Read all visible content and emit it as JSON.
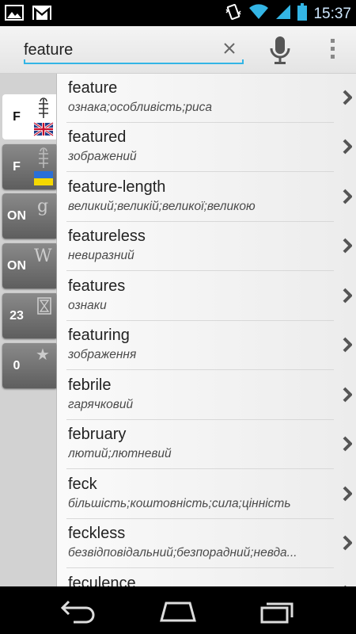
{
  "status_bar": {
    "time": "15:37",
    "left_icons": [
      "image-notification-icon",
      "gmail-notification-icon"
    ],
    "right_icons": [
      "vibrate-icon",
      "wifi-icon",
      "signal-icon",
      "battery-icon"
    ]
  },
  "search": {
    "value": "feature"
  },
  "tabs": [
    {
      "label": "F",
      "icon": "english-dictionary-icon",
      "active": true
    },
    {
      "label": "F",
      "icon": "ukrainian-dictionary-icon",
      "active": false
    },
    {
      "label": "ON",
      "icon": "google-icon",
      "active": false
    },
    {
      "label": "ON",
      "icon": "wikipedia-icon",
      "active": false
    },
    {
      "label": "23",
      "icon": "history-icon",
      "active": false
    },
    {
      "label": "0",
      "icon": "favorites-star-icon",
      "active": false
    }
  ],
  "tab_glyphs": {
    "google": "g",
    "wikipedia": "W",
    "star": "★"
  },
  "results": [
    {
      "word": "feature",
      "translation": "ознака;особливість;риса"
    },
    {
      "word": "featured",
      "translation": "зображений"
    },
    {
      "word": "feature-length",
      "translation": "великий;великій;великої;великою"
    },
    {
      "word": "featureless",
      "translation": "невиразний"
    },
    {
      "word": "features",
      "translation": "ознаки"
    },
    {
      "word": "featuring",
      "translation": "зображення"
    },
    {
      "word": "febrile",
      "translation": "гарячковий"
    },
    {
      "word": "february",
      "translation": "лютий;лютневий"
    },
    {
      "word": "feck",
      "translation": "більшість;коштовність;сила;цінність"
    },
    {
      "word": "feckless",
      "translation": "безвідповідальний;безпорадний;невда..."
    },
    {
      "word": "feculence",
      "translation": ""
    }
  ],
  "nav_bar": [
    "back-icon",
    "home-icon",
    "recent-apps-icon"
  ],
  "colors": {
    "accent": "#33b5e5",
    "tab_dark": "#6e6e6e",
    "ua_blue": "#2a6fd6",
    "ua_yellow": "#f5d800"
  }
}
